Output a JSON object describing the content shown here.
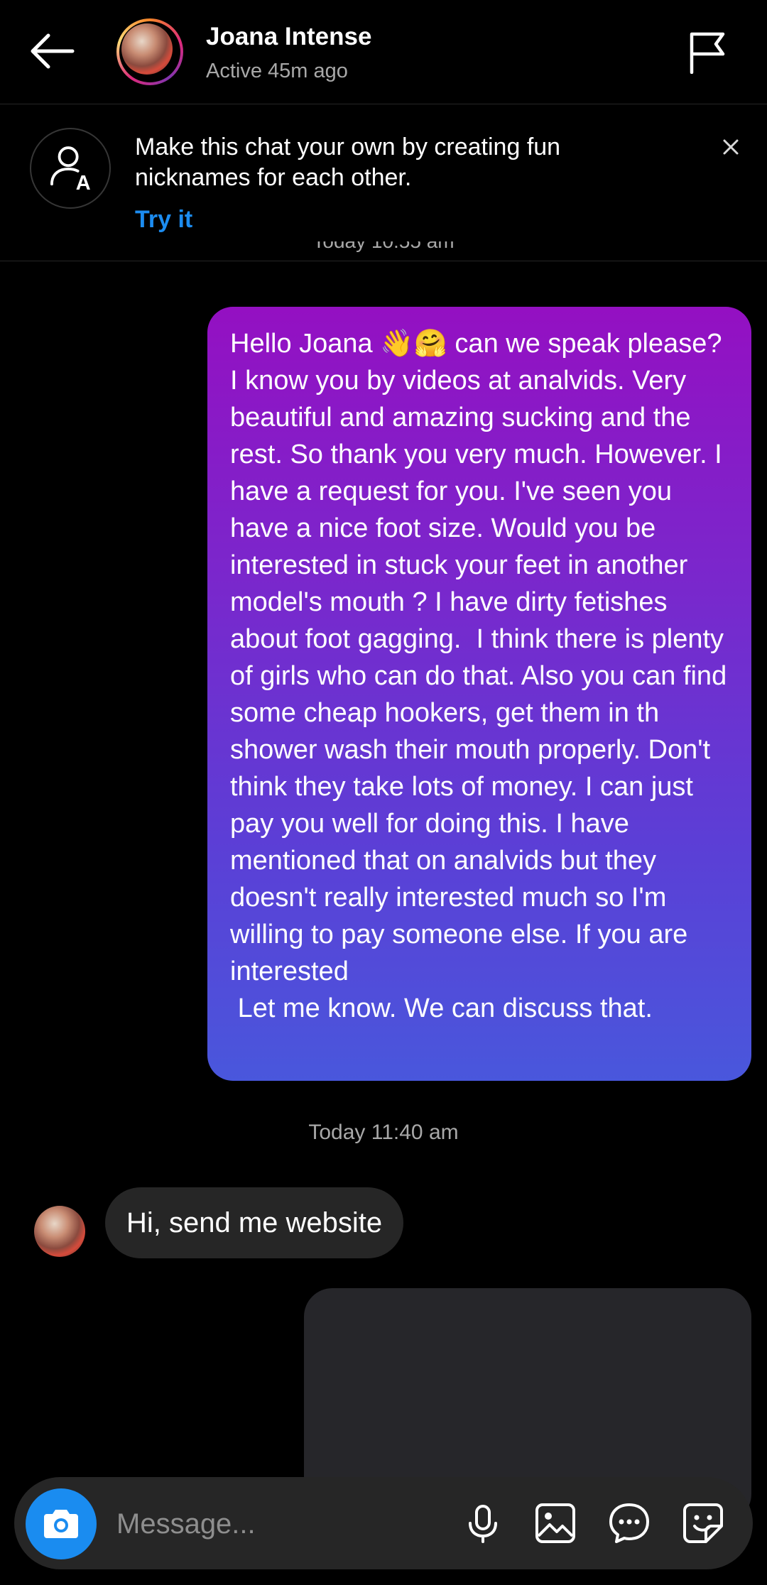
{
  "header": {
    "name": "Joana Intense",
    "status": "Active 45m ago"
  },
  "banner": {
    "text": "Make this chat your own by creating fun nicknames for each other.",
    "action": "Try it"
  },
  "messages": {
    "cut_timestamp": "Today 10:55 am",
    "sent_text": "Hello Joana 👋🤗 can we speak please? I know you by videos at analvids. Very beautiful and amazing sucking and the rest. So thank you very much. However. I have a request for you. I've seen you have a nice foot size. Would you be interested in stuck your feet in another model's mouth ? I have dirty fetishes about foot gagging.  I think there is plenty of girls who can do that. Also you can find some cheap hookers, get them in th shower wash their mouth properly. Don't think they take lots of money. I can just pay you well for doing this. I have mentioned that on analvids but they doesn't really interested much so I'm willing to pay someone else. If you are interested\n Let me know. We can discuss that.",
    "timestamp": "Today 11:40 am",
    "received_text": "Hi, send me website"
  },
  "composer": {
    "placeholder": "Message..."
  },
  "colors": {
    "accent_blue": "#1a8cf0",
    "bubble_gradient_top": "#9410c2",
    "bubble_gradient_bottom": "#4957dc",
    "received_bubble": "#262626"
  }
}
